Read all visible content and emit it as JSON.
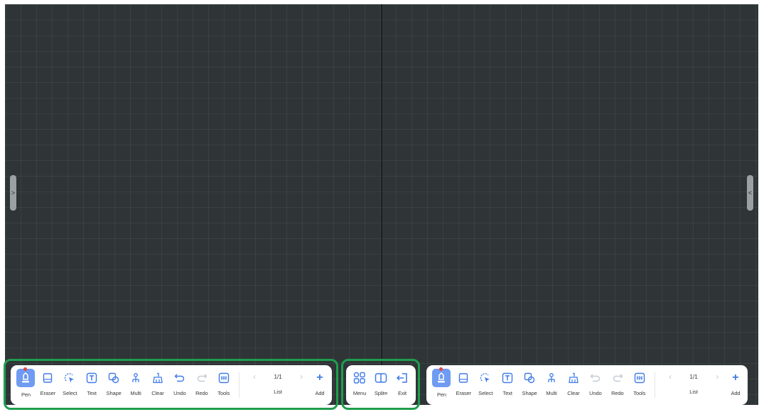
{
  "left_toolbar": {
    "tools": [
      {
        "label": "Pen",
        "icon": "pen-icon"
      },
      {
        "label": "Eraser",
        "icon": "eraser-icon"
      },
      {
        "label": "Select",
        "icon": "select-icon"
      },
      {
        "label": "Text",
        "icon": "text-icon"
      },
      {
        "label": "Shape",
        "icon": "shape-icon"
      },
      {
        "label": "Multi",
        "icon": "multi-icon"
      },
      {
        "label": "Clear",
        "icon": "clear-icon"
      },
      {
        "label": "Undo",
        "icon": "undo-icon"
      },
      {
        "label": "Redo",
        "icon": "redo-icon"
      },
      {
        "label": "Tools",
        "icon": "tools-icon"
      }
    ],
    "page_count": "1/1",
    "list_label": "List",
    "add_label": "Add"
  },
  "middle_toolbar": {
    "menu_label": "Menu",
    "split_label": "Split≡",
    "exit_label": "Exit"
  },
  "right_toolbar": {
    "tools": [
      {
        "label": "Pen",
        "icon": "pen-icon"
      },
      {
        "label": "Eraser",
        "icon": "eraser-icon"
      },
      {
        "label": "Select",
        "icon": "select-icon"
      },
      {
        "label": "Text",
        "icon": "text-icon"
      },
      {
        "label": "Shape",
        "icon": "shape-icon"
      },
      {
        "label": "Multi",
        "icon": "multi-icon"
      },
      {
        "label": "Clear",
        "icon": "clear-icon"
      },
      {
        "label": "Undo",
        "icon": "undo-icon"
      },
      {
        "label": "Redo",
        "icon": "redo-icon"
      },
      {
        "label": "Tools",
        "icon": "tools-icon"
      }
    ],
    "page_count": "1/1",
    "list_label": "List",
    "add_label": "Add"
  },
  "handles": {
    "left_glyph": ">",
    "right_glyph": "<"
  },
  "colors": {
    "board_bg": "#2f3537",
    "accent": "#3f7ae8",
    "active_tool_bg": "#6f9bf2",
    "highlight_border": "#1f9d4e",
    "pen_dot": "#e6463c"
  }
}
